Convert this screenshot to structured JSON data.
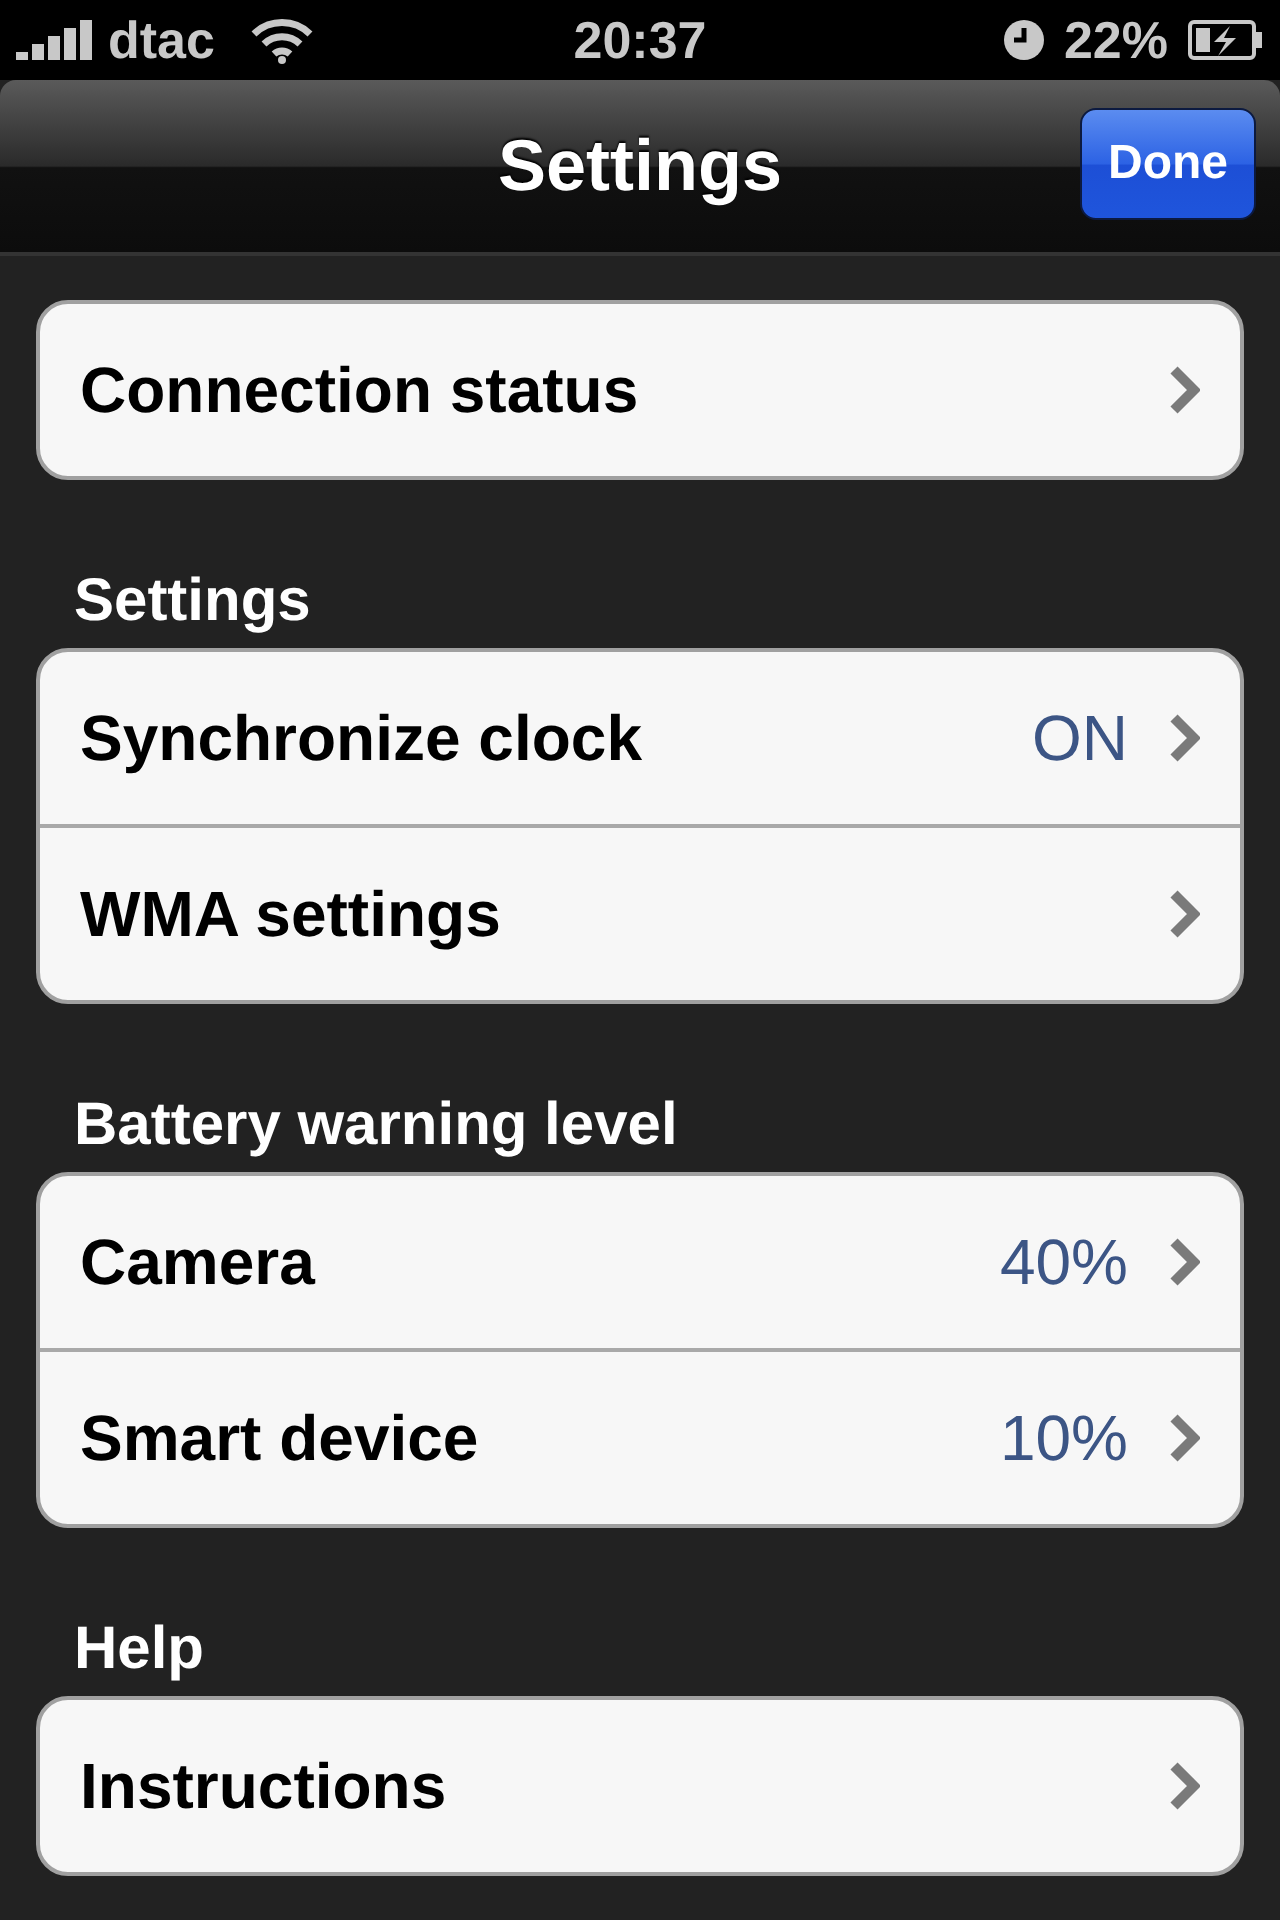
{
  "status_bar": {
    "carrier": "dtac",
    "time": "20:37",
    "battery": "22%"
  },
  "nav_bar": {
    "title": "Settings",
    "done_button": "Done"
  },
  "sections": [
    {
      "rows": [
        {
          "label": "Connection status"
        }
      ]
    },
    {
      "header": "Settings",
      "rows": [
        {
          "label": "Synchronize clock",
          "value": "ON"
        },
        {
          "label": "WMA settings"
        }
      ]
    },
    {
      "header": "Battery warning level",
      "rows": [
        {
          "label": "Camera",
          "value": "40%"
        },
        {
          "label": "Smart device",
          "value": "10%"
        }
      ]
    },
    {
      "header": "Help",
      "rows": [
        {
          "label": "Instructions"
        }
      ]
    }
  ]
}
